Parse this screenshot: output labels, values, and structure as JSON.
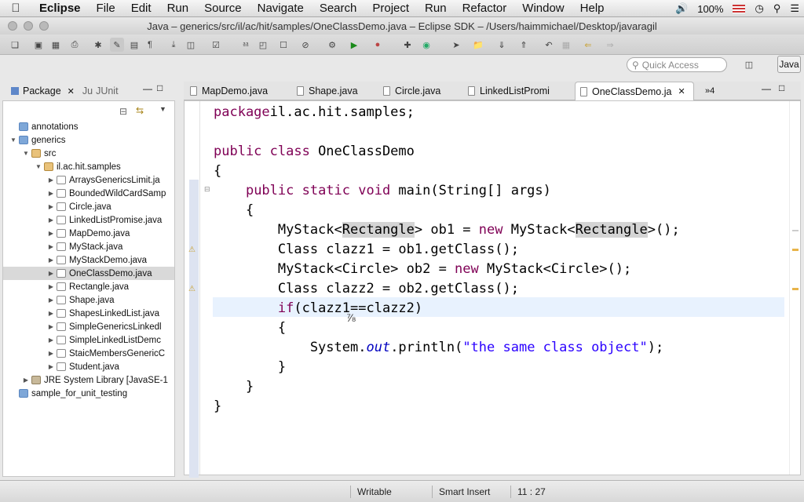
{
  "menubar": {
    "app": "Eclipse",
    "items": [
      "File",
      "Edit",
      "Run",
      "Source",
      "Navigate",
      "Search",
      "Project",
      "Run",
      "Refactor",
      "Window",
      "Help"
    ],
    "battery": "100%"
  },
  "window": {
    "title": "Java – generics/src/il/ac/hit/samples/OneClassDemo.java – Eclipse SDK – /Users/haimmichael/Desktop/javaragil"
  },
  "toolbar": {
    "quick_access_placeholder": "Quick Access",
    "perspective": "Java"
  },
  "left_panel": {
    "tabs": [
      "Package",
      "JUnit"
    ],
    "tree": [
      {
        "label": "annotations",
        "kind": "folder",
        "depth": 0,
        "twisty": ""
      },
      {
        "label": "generics",
        "kind": "folder",
        "depth": 0,
        "twisty": "▼"
      },
      {
        "label": "src",
        "kind": "pkg",
        "depth": 1,
        "twisty": "▼"
      },
      {
        "label": "il.ac.hit.samples",
        "kind": "pkg",
        "depth": 2,
        "twisty": "▼"
      },
      {
        "label": "ArraysGenericsLimit.ja",
        "kind": "java",
        "depth": 3,
        "twisty": "▶"
      },
      {
        "label": "BoundedWildCardSamp",
        "kind": "java",
        "depth": 3,
        "twisty": "▶"
      },
      {
        "label": "Circle.java",
        "kind": "java",
        "depth": 3,
        "twisty": "▶"
      },
      {
        "label": "LinkedListPromise.java",
        "kind": "java",
        "depth": 3,
        "twisty": "▶"
      },
      {
        "label": "MapDemo.java",
        "kind": "java",
        "depth": 3,
        "twisty": "▶"
      },
      {
        "label": "MyStack.java",
        "kind": "java",
        "depth": 3,
        "twisty": "▶"
      },
      {
        "label": "MyStackDemo.java",
        "kind": "java",
        "depth": 3,
        "twisty": "▶"
      },
      {
        "label": "OneClassDemo.java",
        "kind": "java",
        "depth": 3,
        "twisty": "▶",
        "selected": true
      },
      {
        "label": "Rectangle.java",
        "kind": "java",
        "depth": 3,
        "twisty": "▶"
      },
      {
        "label": "Shape.java",
        "kind": "java",
        "depth": 3,
        "twisty": "▶"
      },
      {
        "label": "ShapesLinkedList.java",
        "kind": "java",
        "depth": 3,
        "twisty": "▶"
      },
      {
        "label": "SimpleGenericsLinkedl",
        "kind": "java",
        "depth": 3,
        "twisty": "▶"
      },
      {
        "label": "SimpleLinkedListDemc",
        "kind": "java",
        "depth": 3,
        "twisty": "▶"
      },
      {
        "label": "StaicMembersGenericC",
        "kind": "java",
        "depth": 3,
        "twisty": "▶"
      },
      {
        "label": "Student.java",
        "kind": "java",
        "depth": 3,
        "twisty": "▶"
      },
      {
        "label": "JRE System Library [JavaSE-1",
        "kind": "lib",
        "depth": 1,
        "twisty": "▶"
      },
      {
        "label": "sample_for_unit_testing",
        "kind": "folder",
        "depth": 0,
        "twisty": ""
      }
    ]
  },
  "editor": {
    "tabs": [
      "MapDemo.java",
      "Shape.java",
      "Circle.java",
      "LinkedListPromi",
      "OneClassDemo.ja"
    ],
    "active_tab": 4,
    "overflow": "»4",
    "code": [
      [
        [
          "kw",
          "package"
        ],
        [
          "",
          "il.ac.hit.samples;"
        ]
      ],
      [],
      [
        [
          "kw",
          "public class"
        ],
        [
          "",
          " OneClassDemo"
        ]
      ],
      [
        [
          "",
          "{"
        ]
      ],
      [
        [
          "",
          "    "
        ],
        [
          "kw",
          "public static void"
        ],
        [
          "",
          " main(String[] args)"
        ]
      ],
      [
        [
          "",
          "    {"
        ]
      ],
      [
        [
          "",
          "        MyStack<"
        ],
        [
          "hl",
          "Rectangle"
        ],
        [
          "",
          "> ob1 = "
        ],
        [
          "kw",
          "new"
        ],
        [
          "",
          " MyStack<"
        ],
        [
          "hl",
          "Rectangle"
        ],
        [
          "",
          ">();"
        ]
      ],
      [
        [
          "",
          "        Class clazz1 = ob1.getClass();"
        ]
      ],
      [
        [
          "",
          "        MyStack<Circle> ob2 = "
        ],
        [
          "kw",
          "new"
        ],
        [
          "",
          " MyStack<Circle>();"
        ]
      ],
      [
        [
          "",
          "        Class clazz2 = ob2.getClass();"
        ]
      ],
      [
        [
          "",
          "        "
        ],
        [
          "kw",
          "if"
        ],
        [
          "",
          "(clazz1==clazz2)"
        ]
      ],
      [
        [
          "",
          "        {"
        ]
      ],
      [
        [
          "",
          "            System."
        ],
        [
          "fld",
          "out"
        ],
        [
          "",
          ".println("
        ],
        [
          "str",
          "\"the same class object\""
        ],
        [
          "",
          ");"
        ]
      ],
      [
        [
          "",
          "        }"
        ]
      ],
      [
        [
          "",
          "    }"
        ]
      ],
      [
        [
          "",
          "}"
        ]
      ]
    ]
  },
  "status": {
    "mode": "Writable",
    "insert": "Smart Insert",
    "position": "11 : 27"
  }
}
